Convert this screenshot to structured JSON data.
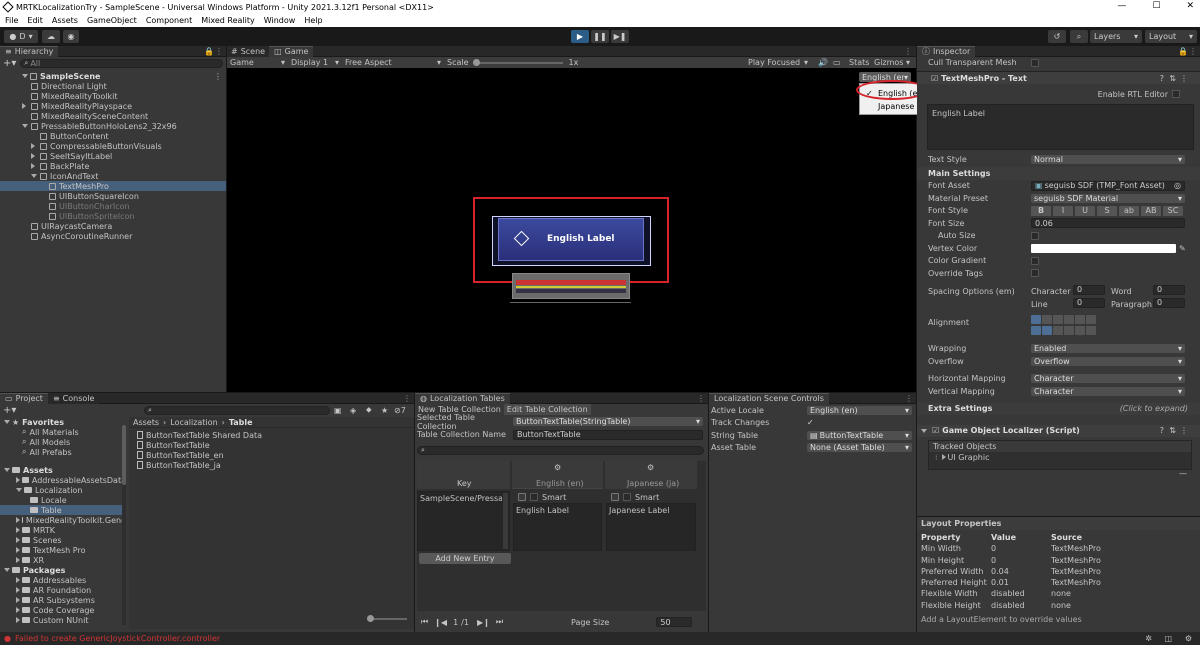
{
  "window": {
    "title": "MRTKLocalizationTry - SampleScene - Universal Windows Platform - Unity 2021.3.12f1 Personal <DX11>",
    "controls": [
      "—",
      "☐",
      "✕"
    ]
  },
  "menu": [
    "File",
    "Edit",
    "Assets",
    "GameObject",
    "Component",
    "Mixed Reality",
    "Window",
    "Help"
  ],
  "toolbar": {
    "account": "D",
    "layers": "Layers",
    "layout": "Layout"
  },
  "hierarchy": {
    "tab": "Hierarchy",
    "search_placeholder": "All",
    "items": [
      {
        "label": "SampleScene",
        "depth": 0,
        "kind": "scene"
      },
      {
        "label": "Directional Light",
        "depth": 1,
        "kind": "go"
      },
      {
        "label": "MixedRealityToolkit",
        "depth": 1,
        "kind": "go"
      },
      {
        "label": "MixedRealityPlayspace",
        "depth": 1,
        "kind": "go",
        "arrow": "right"
      },
      {
        "label": "MixedRealitySceneContent",
        "depth": 1,
        "kind": "go"
      },
      {
        "label": "PressableButtonHoloLens2_32x96",
        "depth": 1,
        "kind": "go",
        "arrow": "down"
      },
      {
        "label": "ButtonContent",
        "depth": 2,
        "kind": "go"
      },
      {
        "label": "CompressableButtonVisuals",
        "depth": 2,
        "kind": "go",
        "arrow": "right"
      },
      {
        "label": "SeeItSayItLabel",
        "depth": 2,
        "kind": "go",
        "arrow": "right"
      },
      {
        "label": "BackPlate",
        "depth": 2,
        "kind": "go",
        "arrow": "right"
      },
      {
        "label": "IconAndText",
        "depth": 2,
        "kind": "go",
        "arrow": "down"
      },
      {
        "label": "TextMeshPro",
        "depth": 3,
        "kind": "go",
        "selected": true
      },
      {
        "label": "UIButtonSquareIcon",
        "depth": 3,
        "kind": "go"
      },
      {
        "label": "UIButtonCharIcon",
        "depth": 3,
        "kind": "go",
        "dim": true
      },
      {
        "label": "UIButtonSpriteIcon",
        "depth": 3,
        "kind": "go",
        "dim": true
      },
      {
        "label": "UIRaycastCamera",
        "depth": 1,
        "kind": "go"
      },
      {
        "label": "AsyncCoroutineRunner",
        "depth": 1,
        "kind": "go"
      }
    ]
  },
  "game": {
    "tabs": [
      "Scene",
      "Game"
    ],
    "display_mode": "Game",
    "display": "Display 1",
    "aspect": "Free Aspect",
    "scale_label": "Scale",
    "scale_value": "1x",
    "play_focused": "Play Focused",
    "stats": "Stats",
    "gizmos": "Gizmos",
    "button_label": "English Label",
    "locale_dropdown": "English (en)",
    "locale_options": [
      {
        "label": "English (en)",
        "checked": true
      },
      {
        "label": "Japanese (ja)",
        "checked": false
      }
    ]
  },
  "inspector": {
    "tab": "Inspector",
    "top_row": "Cull Transparent Mesh",
    "component": "TextMeshPro - Text",
    "rtl": "Enable RTL Editor",
    "text_value": "English Label",
    "rows": [
      {
        "label": "Text Style",
        "value": "Normal",
        "type": "drop"
      },
      {
        "label": "Main Settings",
        "type": "section"
      },
      {
        "label": "Font Asset",
        "value": "seguisb SDF (TMP_Font Asset)",
        "type": "obj"
      },
      {
        "label": "Material Preset",
        "value": "seguisb SDF Material",
        "type": "drop"
      },
      {
        "label": "Font Style",
        "type": "style"
      },
      {
        "label": "Font Size",
        "value": "0.06",
        "type": "field"
      },
      {
        "label": "Auto Size",
        "type": "check",
        "indent": true
      },
      {
        "label": "Vertex Color",
        "type": "color"
      },
      {
        "label": "Color Gradient",
        "type": "check"
      },
      {
        "label": "Override Tags",
        "type": "check"
      }
    ],
    "font_style_buttons": [
      "B",
      "I",
      "U",
      "S",
      "ab",
      "AB",
      "SC"
    ],
    "spacing_label": "Spacing Options (em)",
    "spacing": [
      {
        "label": "Character",
        "value": "0"
      },
      {
        "label": "Word",
        "value": "0"
      },
      {
        "label": "Line",
        "value": "0"
      },
      {
        "label": "Paragraph",
        "value": "0"
      }
    ],
    "alignment_label": "Alignment",
    "rows2": [
      {
        "label": "Wrapping",
        "value": "Enabled"
      },
      {
        "label": "Overflow",
        "value": "Overflow"
      },
      {
        "label": "Horizontal Mapping",
        "value": "Character"
      },
      {
        "label": "Vertical Mapping",
        "value": "Character"
      }
    ],
    "extra_settings": "Extra Settings",
    "extra_hint": "(Click to expand)",
    "localizer": "Game Object Localizer (Script)",
    "tracked_objects": "Tracked Objects",
    "tracked_item": "UI Graphic"
  },
  "layout_props": {
    "title": "Layout Properties",
    "headers": [
      "Property",
      "Value",
      "Source"
    ],
    "rows": [
      [
        "Min Width",
        "0",
        "TextMeshPro"
      ],
      [
        "Min Height",
        "0",
        "TextMeshPro"
      ],
      [
        "Preferred Width",
        "0.04",
        "TextMeshPro"
      ],
      [
        "Preferred Height",
        "0.01",
        "TextMeshPro"
      ],
      [
        "Flexible Width",
        "disabled",
        "none"
      ],
      [
        "Flexible Height",
        "disabled",
        "none"
      ]
    ],
    "footer": "Add a LayoutElement to override values"
  },
  "project": {
    "tabs": [
      "Project",
      "Console"
    ],
    "favorites_header": "Favorites",
    "favorites": [
      "All Materials",
      "All Models",
      "All Prefabs"
    ],
    "assets_header": "Assets",
    "tree": [
      {
        "label": "AddressableAssetsData",
        "depth": 1
      },
      {
        "label": "Localization",
        "depth": 1,
        "open": true
      },
      {
        "label": "Locale",
        "depth": 2
      },
      {
        "label": "Table",
        "depth": 2,
        "selected": true
      },
      {
        "label": "MixedRealityToolkit.Gene",
        "depth": 1
      },
      {
        "label": "MRTK",
        "depth": 1
      },
      {
        "label": "Scenes",
        "depth": 1
      },
      {
        "label": "TextMesh Pro",
        "depth": 1
      },
      {
        "label": "XR",
        "depth": 1
      }
    ],
    "packages_header": "Packages",
    "packages": [
      "Addressables",
      "AR Foundation",
      "AR Subsystems",
      "Code Coverage",
      "Custom NUnit"
    ],
    "breadcrumb": [
      "Assets",
      "Localization",
      "Table"
    ],
    "files": [
      "ButtonTextTable Shared Data",
      "ButtonTextTable",
      "ButtonTextTable_en",
      "ButtonTextTable_ja"
    ],
    "hidden_count": "7"
  },
  "loc_tables": {
    "tab": "Localization Tables",
    "tabs": [
      "New Table Collection",
      "Edit Table Collection"
    ],
    "selected_label": "Selected Table Collection",
    "selected_value": "ButtonTextTable(StringTable)",
    "name_label": "Table Collection Name",
    "name_value": "ButtonTextTable",
    "col_key": "Key",
    "col_en": "English (en)",
    "col_ja": "Japanese (ja)",
    "smart": "Smart",
    "key_value": "SampleScene/Pressal",
    "en_value": "English Label",
    "ja_value": "Japanese Label",
    "add_entry": "Add New Entry",
    "page": "1",
    "page_size_label": "Page Size",
    "page_size": "50"
  },
  "loc_scene": {
    "tab": "Localization Scene Controls",
    "rows": [
      {
        "label": "Active Locale",
        "value": "English (en)"
      },
      {
        "label": "Track Changes",
        "value": "✓"
      },
      {
        "label": "String Table",
        "value": "ButtonTextTable"
      },
      {
        "label": "Asset Table",
        "value": "None (Asset Table)"
      }
    ]
  },
  "status": {
    "error": "Failed to create GenericJoystickController.controller"
  },
  "colors": {
    "accent": "#2c5d87",
    "error": "#d03434",
    "highlight": "#d5242b"
  }
}
